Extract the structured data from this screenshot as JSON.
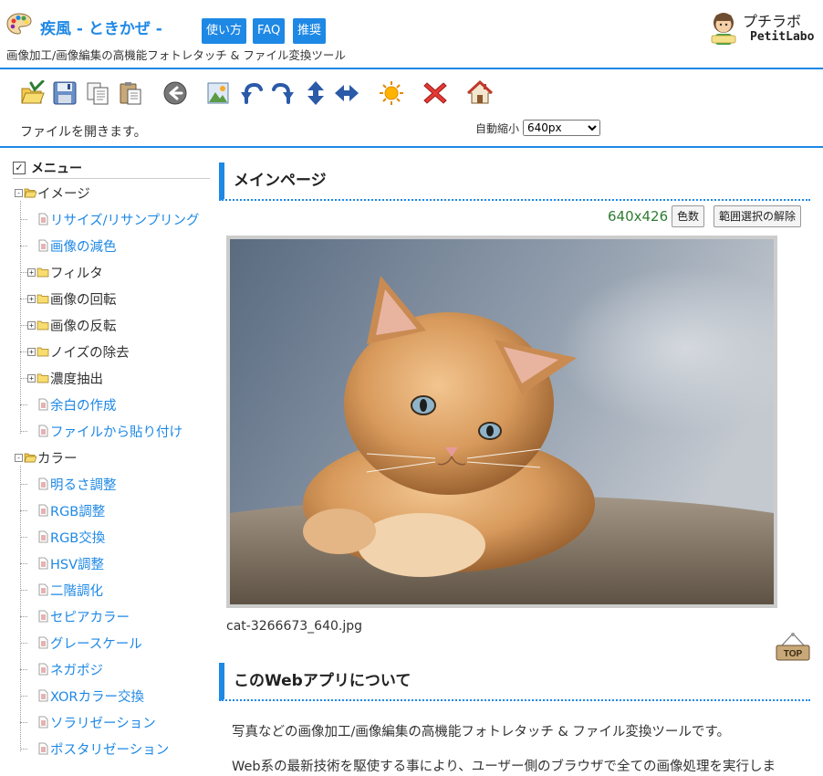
{
  "header": {
    "title": "疾風 - ときかぜ -",
    "nav": [
      "使い方",
      "FAQ",
      "推奨"
    ],
    "subtitle": "画像加工/画像編集の高機能フォトレタッチ & ファイル変換ツール",
    "brand_jp": "プチラボ",
    "brand_en": "PetitLabo"
  },
  "toolbar": {
    "icons": [
      "open-icon",
      "save-icon",
      "copy-icon",
      "paste-icon",
      "back-icon",
      "image-icon",
      "rotate-left-icon",
      "rotate-right-icon",
      "flip-vertical-icon",
      "flip-horizontal-icon",
      "effect-icon",
      "delete-icon",
      "home-icon"
    ],
    "status": "ファイルを開きます。",
    "auto_shrink_label": "自動縮小",
    "auto_shrink_value": "640px"
  },
  "sidebar": {
    "heading": "メニュー",
    "image_group": {
      "label": "イメージ",
      "items": [
        {
          "label": "リサイズ/リサンプリング",
          "type": "link"
        },
        {
          "label": "画像の減色",
          "type": "link"
        },
        {
          "label": "フィルタ",
          "type": "folder"
        },
        {
          "label": "画像の回転",
          "type": "folder"
        },
        {
          "label": "画像の反転",
          "type": "folder"
        },
        {
          "label": "ノイズの除去",
          "type": "folder"
        },
        {
          "label": "濃度抽出",
          "type": "folder"
        },
        {
          "label": "余白の作成",
          "type": "link"
        },
        {
          "label": "ファイルから貼り付け",
          "type": "link"
        }
      ]
    },
    "color_group": {
      "label": "カラー",
      "items": [
        {
          "label": "明るさ調整"
        },
        {
          "label": "RGB調整"
        },
        {
          "label": "RGB交換"
        },
        {
          "label": "HSV調整"
        },
        {
          "label": "二階調化"
        },
        {
          "label": "セピアカラー"
        },
        {
          "label": "グレースケール"
        },
        {
          "label": "ネガポジ"
        },
        {
          "label": "XORカラー交換"
        },
        {
          "label": "ソラリゼーション"
        },
        {
          "label": "ポスタリゼーション"
        }
      ]
    }
  },
  "main": {
    "section1_title": "メインページ",
    "image_size": "640x426",
    "colors_button": "色数",
    "clear_selection_button": "範囲選択の解除",
    "filename": "cat-3266673_640.jpg",
    "top_label": "TOP",
    "section2_title": "このWebアプリについて",
    "para1": "写真などの画像加工/画像編集の高機能フォトレタッチ & ファイル変換ツールです。",
    "para2": "Web系の最新技術を駆使する事により、ユーザー側のブラウザで全ての画像処理を実行しま"
  },
  "colors": {
    "accent": "#1e88e5",
    "size_text": "#2e7d32"
  }
}
